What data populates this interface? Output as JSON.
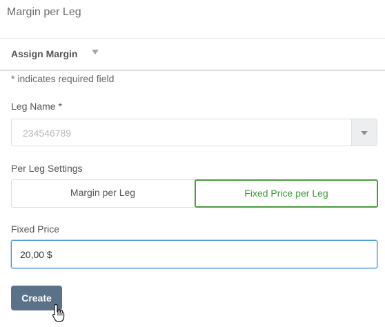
{
  "page": {
    "title": "Margin per Leg"
  },
  "section": {
    "title": "Assign Margin"
  },
  "form": {
    "required_note": "* indicates required field",
    "leg_name": {
      "label": "Leg Name *",
      "value": "234546789"
    },
    "per_leg_settings": {
      "label": "Per Leg Settings",
      "options": [
        "Margin per Leg",
        "Fixed Price per Leg"
      ],
      "selected": "Fixed Price per Leg"
    },
    "fixed_price": {
      "label": "Fixed Price",
      "value": "20,00 $"
    },
    "create_label": "Create"
  },
  "icons": {
    "section_toggle": "caret-down-icon",
    "select_toggle": "chevron-down-icon",
    "cursor": "hand-pointer-cursor-icon"
  },
  "colors": {
    "accent_green": "#4a9d3f",
    "focus_blue": "#3d8fd6",
    "button_bg": "#5b7189"
  }
}
